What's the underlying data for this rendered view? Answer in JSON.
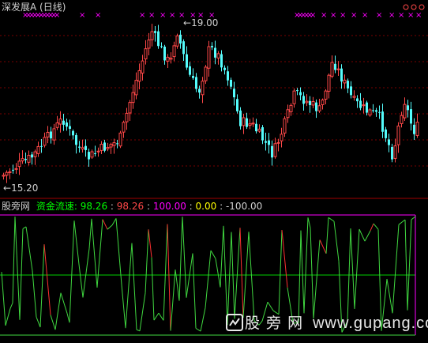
{
  "title": "深发展A (日线)",
  "price_chart": {
    "high_label": "19.00",
    "low_label": "15.20",
    "up_color": "#ff4848",
    "down_color": "#54fcfc",
    "marker_color": "#ff00ff",
    "marker_glyph": "×"
  },
  "indicator": {
    "site_name": "股旁网",
    "name": "资金流速:",
    "values": [
      "98.26",
      "98.26",
      "100.00",
      "0.00",
      "-100.00"
    ],
    "value_colors": [
      "#00ff00",
      "#ff4848",
      "#ff00ff",
      "#ffff00",
      "#d0d0d0"
    ],
    "line_colors": {
      "green": "#40d840",
      "red": "#ff3030",
      "top": "#ff00ff",
      "mid": "#00d000"
    }
  },
  "watermark": {
    "text": "股 旁 网",
    "url": "www.gupang.com"
  },
  "colors": {
    "background": "#000000",
    "separator": "#a00000",
    "grid": "#7a0000"
  }
}
